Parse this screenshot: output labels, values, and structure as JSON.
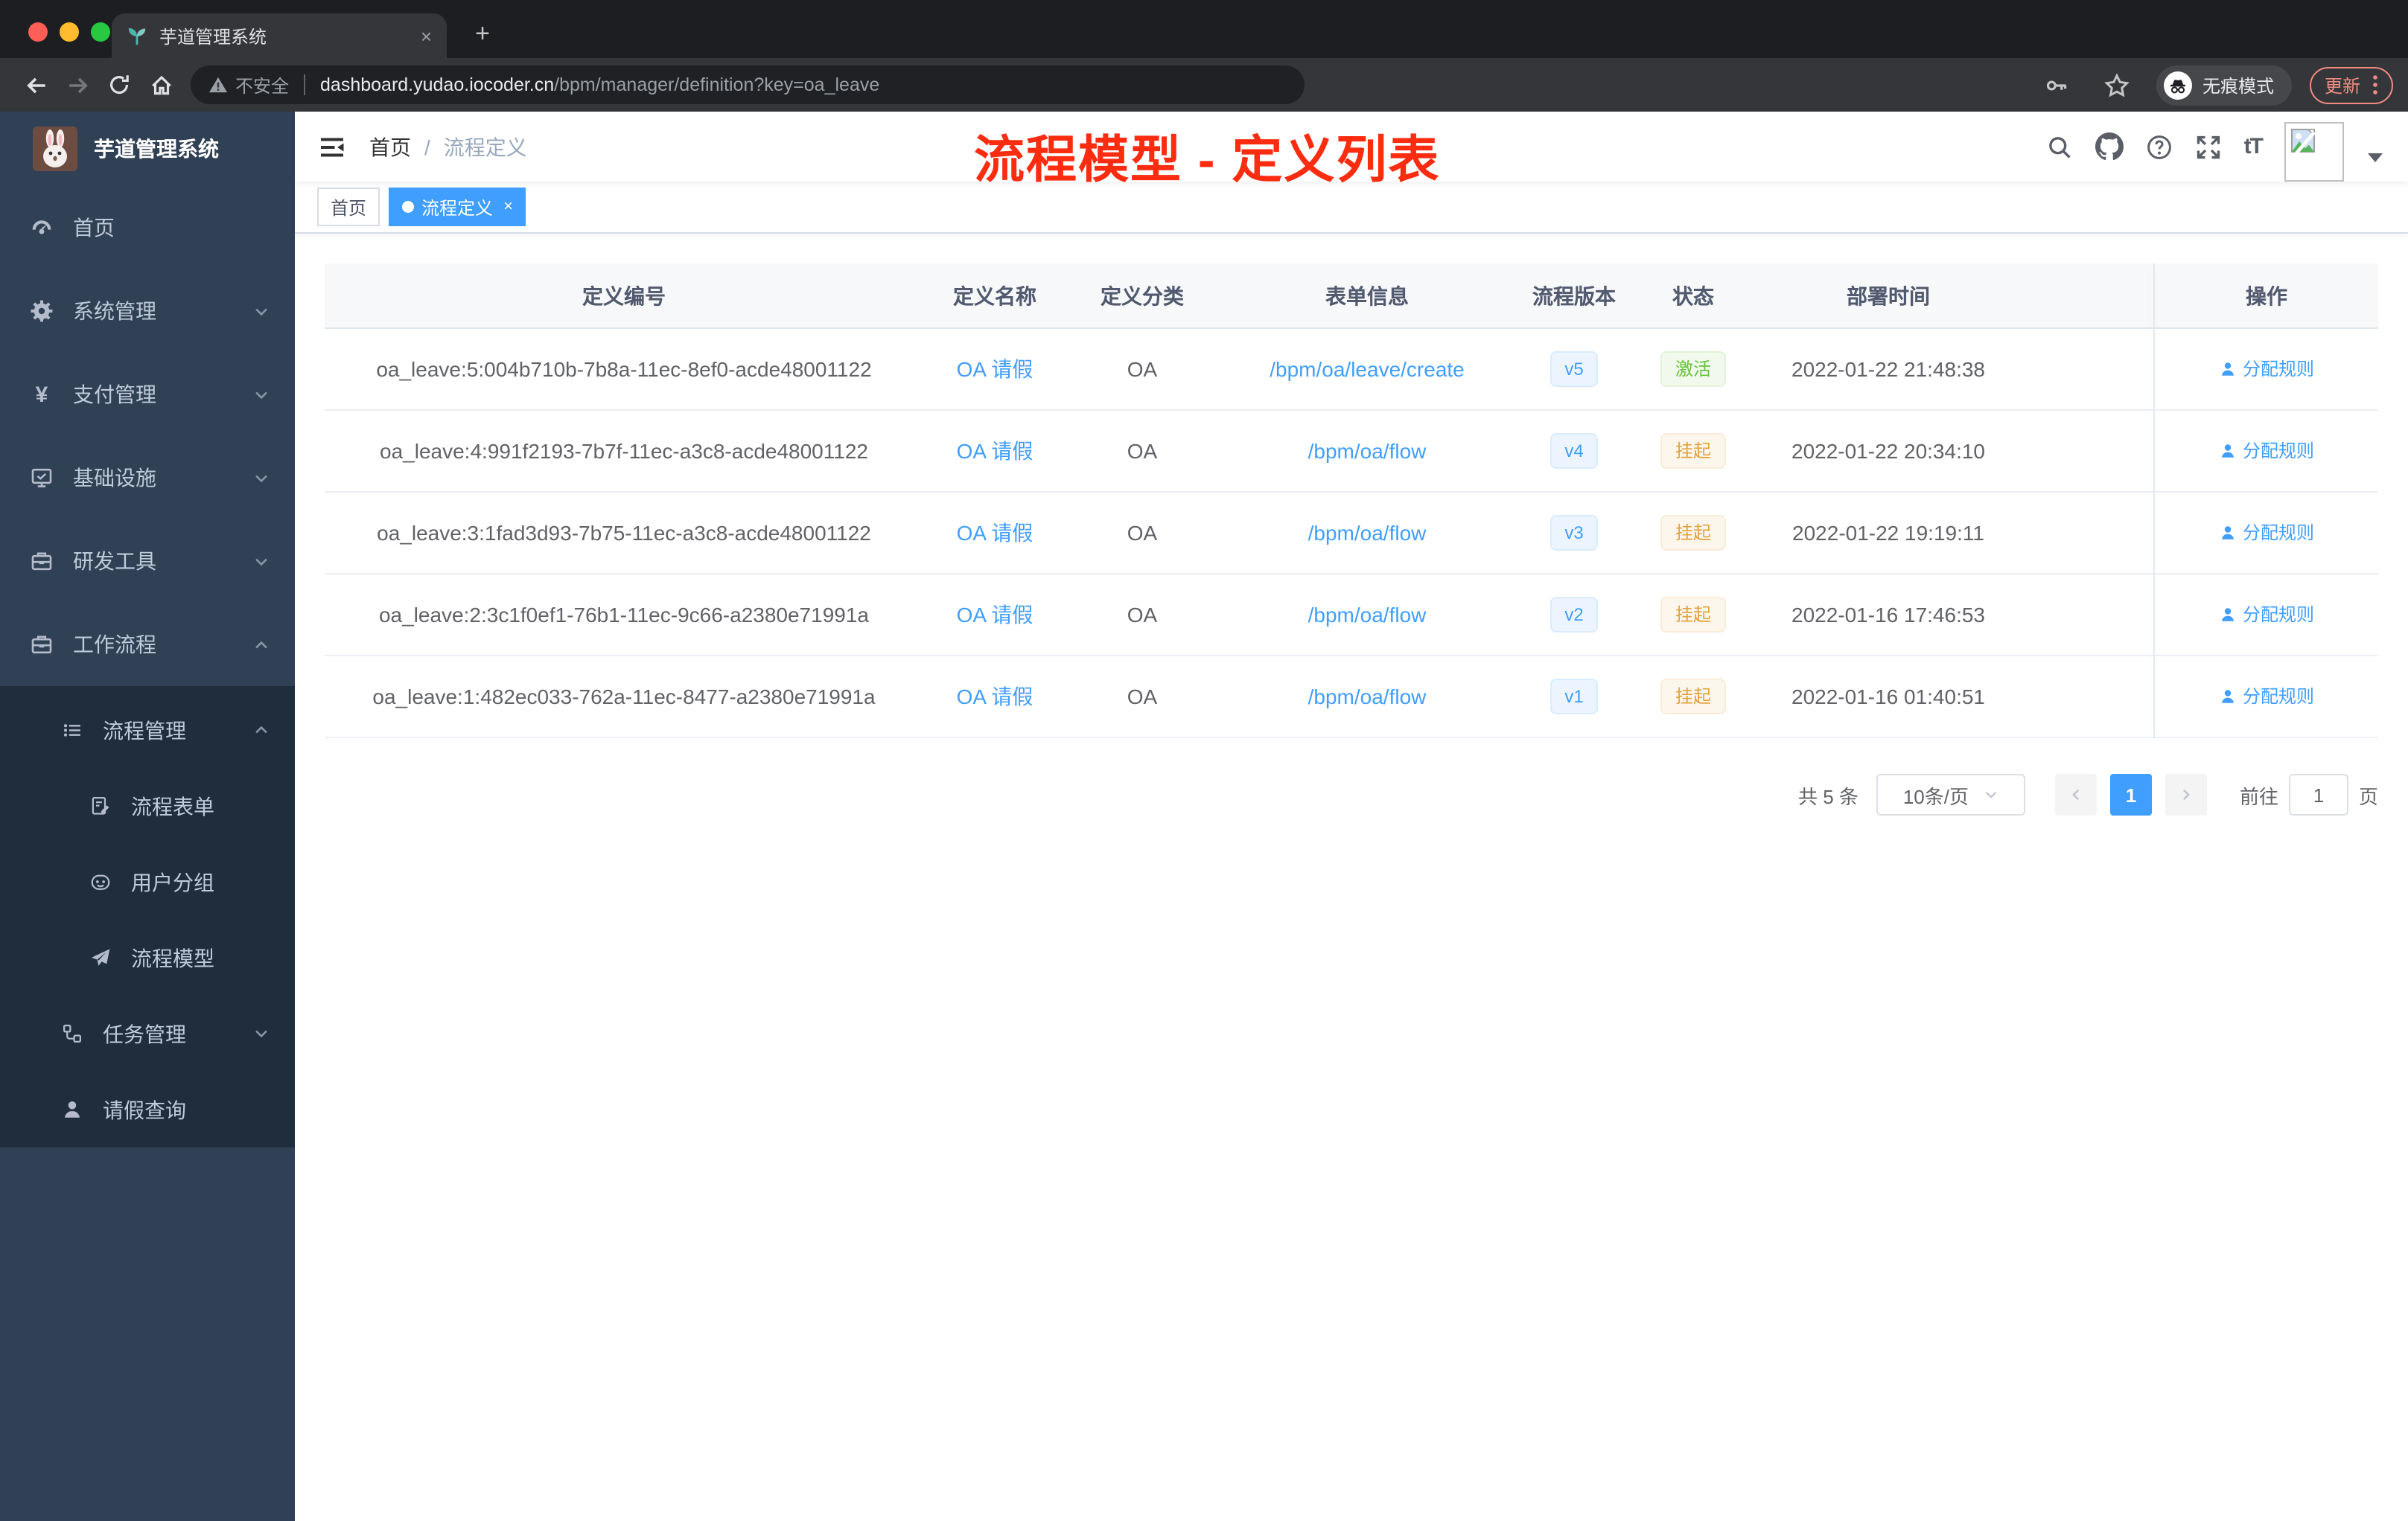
{
  "browser": {
    "tab": {
      "title": "芋道管理系统",
      "close_glyph": "×",
      "new_tab_glyph": "+"
    },
    "address": {
      "security": "不安全",
      "host": "dashboard.yudao.iocoder.cn",
      "path": "/bpm/manager/definition?key=oa_leave"
    },
    "right": {
      "incognito": "无痕模式",
      "update": "更新"
    }
  },
  "sidebar": {
    "title": "芋道管理系统",
    "items": [
      {
        "label": "首页"
      },
      {
        "label": "系统管理"
      },
      {
        "label": "支付管理"
      },
      {
        "label": "基础设施"
      },
      {
        "label": "研发工具"
      },
      {
        "label": "工作流程"
      },
      {
        "label": "流程管理"
      },
      {
        "label": "流程表单"
      },
      {
        "label": "用户分组"
      },
      {
        "label": "流程模型"
      },
      {
        "label": "任务管理"
      },
      {
        "label": "请假查询"
      }
    ]
  },
  "header": {
    "breadcrumb_home": "首页",
    "breadcrumb_sep": "/",
    "breadcrumb_current": "流程定义",
    "annotation": "流程模型 - 定义列表",
    "font_icon_label": "tT"
  },
  "tags": {
    "home": "首页",
    "active": "流程定义",
    "close_glyph": "×"
  },
  "table": {
    "headers": [
      "定义编号",
      "定义名称",
      "定义分类",
      "表单信息",
      "流程版本",
      "状态",
      "部署时间",
      "操作"
    ],
    "action_label": "分配规则",
    "rows": [
      {
        "id": "oa_leave:5:004b710b-7b8a-11ec-8ef0-acde48001122",
        "name": "OA 请假",
        "category": "OA",
        "form": "/bpm/oa/leave/create",
        "version": "v5",
        "status": "激活",
        "status_type": "success",
        "time": "2022-01-22 21:48:38"
      },
      {
        "id": "oa_leave:4:991f2193-7b7f-11ec-a3c8-acde48001122",
        "name": "OA 请假",
        "category": "OA",
        "form": "/bpm/oa/flow",
        "version": "v4",
        "status": "挂起",
        "status_type": "warning",
        "time": "2022-01-22 20:34:10"
      },
      {
        "id": "oa_leave:3:1fad3d93-7b75-11ec-a3c8-acde48001122",
        "name": "OA 请假",
        "category": "OA",
        "form": "/bpm/oa/flow",
        "version": "v3",
        "status": "挂起",
        "status_type": "warning",
        "time": "2022-01-22 19:19:11"
      },
      {
        "id": "oa_leave:2:3c1f0ef1-76b1-11ec-9c66-a2380e71991a",
        "name": "OA 请假",
        "category": "OA",
        "form": "/bpm/oa/flow",
        "version": "v2",
        "status": "挂起",
        "status_type": "warning",
        "time": "2022-01-16 17:46:53"
      },
      {
        "id": "oa_leave:1:482ec033-762a-11ec-8477-a2380e71991a",
        "name": "OA 请假",
        "category": "OA",
        "form": "/bpm/oa/flow",
        "version": "v1",
        "status": "挂起",
        "status_type": "warning",
        "time": "2022-01-16 01:40:51"
      }
    ]
  },
  "pagination": {
    "total": "共 5 条",
    "page_size": "10条/页",
    "page": "1",
    "goto": "前往",
    "goto_value": "1",
    "unit": "页"
  },
  "colors": {
    "accent": "#409eff",
    "success": "#67c23a",
    "warning": "#e6a23c",
    "annotation_red": "#fb2c10",
    "sidebar_bg": "#304156",
    "submenu_bg": "#1f2d3d",
    "tag_blue_bg": "#ecf5ff",
    "status_green_bg": "#f0f9eb",
    "status_orange_bg": "#fdf6ec",
    "traffic_red": "#ff5f57",
    "traffic_yellow": "#febc2e",
    "traffic_green": "#28c840"
  }
}
